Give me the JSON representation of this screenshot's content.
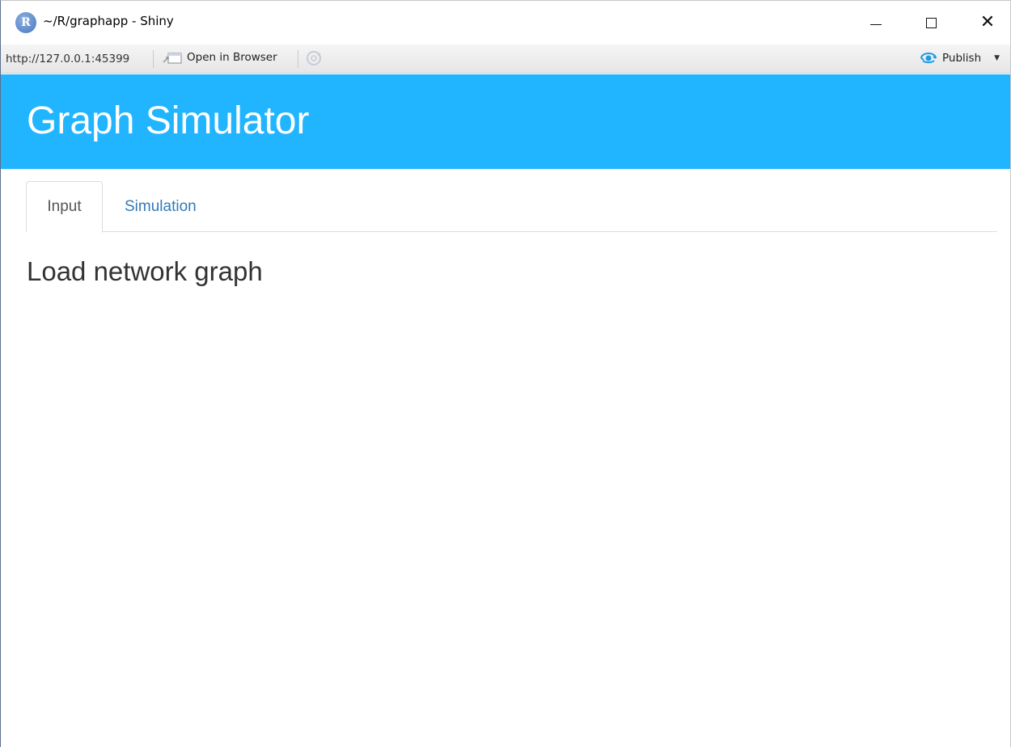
{
  "window": {
    "title": "~/R/graphapp - Shiny",
    "logo_letter": "R"
  },
  "toolbar": {
    "url": "http://127.0.0.1:45399",
    "open_in_browser": "Open in Browser",
    "publish": "Publish"
  },
  "app": {
    "title": "Graph Simulator",
    "header_color": "#21b5ff"
  },
  "tabs": [
    {
      "label": "Input",
      "active": true
    },
    {
      "label": "Simulation",
      "active": false
    }
  ],
  "content": {
    "heading": "Load network graph"
  },
  "icons": {
    "minimize": "minimize-icon",
    "maximize": "maximize-icon",
    "close": "close-icon",
    "open_browser": "open-browser-icon",
    "refresh": "refresh-icon",
    "publish": "publish-icon"
  }
}
